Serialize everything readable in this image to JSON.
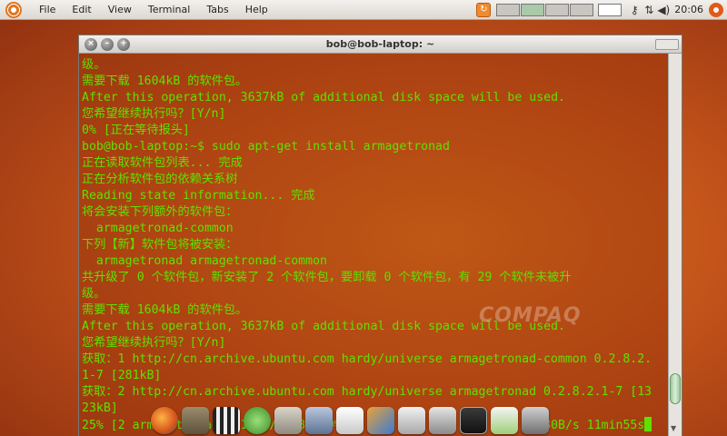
{
  "panel": {
    "menus": [
      "File",
      "Edit",
      "View",
      "Terminal",
      "Tabs",
      "Help"
    ],
    "clock": "20:06"
  },
  "window": {
    "title": "bob@bob-laptop: ~"
  },
  "terminal": {
    "lines": [
      "级。",
      "需要下载 1604kB 的软件包。",
      "After this operation, 3637kB of additional disk space will be used.",
      "您希望继续执行吗？[Y/n]",
      "0% [正在等待报头]",
      "bob@bob-laptop:~$ sudo apt-get install armagetronad",
      "正在读取软件包列表... 完成",
      "正在分析软件包的依赖关系树",
      "Reading state information... 完成",
      "将会安装下列额外的软件包：",
      "  armagetronad-common",
      "下列【新】软件包将被安装：",
      "  armagetronad armagetronad-common",
      "共升级了 0 个软件包，新安装了 2 个软件包，要卸载 0 个软件包，有 29 个软件未被升",
      "级。",
      "需要下载 1604kB 的软件包。",
      "After this operation, 3637kB of additional disk space will be used.",
      "您希望继续执行吗？[Y/n]",
      "获取：1 http://cn.archive.ubuntu.com hardy/universe armagetronad-common 0.2.8.2.",
      "1-7 [281kB]",
      "获取：2 http://cn.archive.ubuntu.com hardy/universe armagetronad 0.2.8.2.1-7 [13",
      "23kB]",
      "25% [2 armagetronad 121615/1323kB 9%]                         1680B/s 11min55s"
    ]
  },
  "watermark": "COMPAQ",
  "colors": {
    "terminal_text": "#5fe000",
    "desktop": "#c4541a"
  },
  "dock": {
    "icons": [
      "firefox-icon",
      "gimp-icon",
      "video-editor-icon",
      "music-icon",
      "file-manager-icon",
      "archive-icon",
      "document-icon",
      "image-viewer-icon",
      "presentation-icon",
      "graphics-icon",
      "terminal-icon",
      "text-editor-icon",
      "network-icon"
    ]
  }
}
